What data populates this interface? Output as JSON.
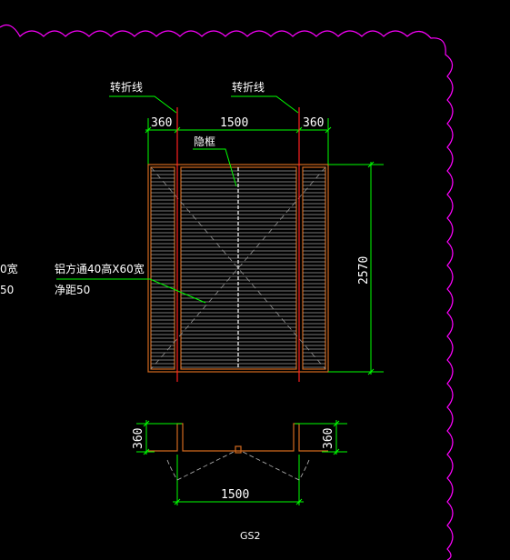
{
  "drawing": {
    "labels": {
      "fold_line_left": "转折线",
      "fold_line_right": "转折线",
      "hidden_frame": "隐框",
      "material_line1": "铝方通40高X60宽",
      "material_line2": "净距50",
      "clipped_line1": "0宽",
      "clipped_line2": "50",
      "drawing_code": "GS2"
    },
    "dimensions": {
      "top_left": "360",
      "top_center": "1500",
      "top_right": "360",
      "height_right": "2570",
      "section_left": "360",
      "section_right": "360",
      "section_bottom": "1500"
    },
    "colors": {
      "background": "#000000",
      "dimension_green": "#00ff00",
      "fold_line_red": "#ff2020",
      "frame_orange": "#d2691e",
      "slat_gray": "#a0a0a0",
      "border_magenta": "#ff00ff",
      "text_white": "#ffffff"
    }
  }
}
